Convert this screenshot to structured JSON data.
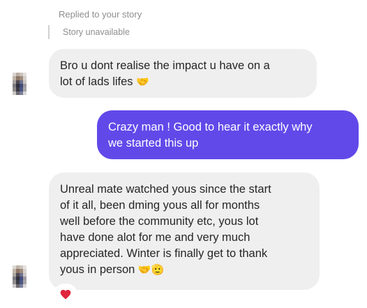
{
  "reply_header": "Replied to your story",
  "story_status": "Story unavailable",
  "messages": [
    {
      "direction": "incoming",
      "lines": [
        "Bro u dont realise the impact u have on a",
        "lot of lads lifes"
      ],
      "trailing_emoji": "🤝"
    },
    {
      "direction": "outgoing",
      "lines": [
        "Crazy man ! Good to hear it exactly why",
        "we started this up"
      ]
    },
    {
      "direction": "incoming",
      "lines": [
        "Unreal mate watched yous since the start",
        "of it all, been dming yous all for months",
        "well before the community etc, yous lot",
        "have done alot for me and very much",
        "appreciated. Winter is finally get to thank",
        "yous in person"
      ],
      "trailing_emoji": "🤝🫡"
    }
  ],
  "reaction": {
    "icon": "heart-icon",
    "color": "#e0243c"
  },
  "colors": {
    "incoming_bubble": "#efefef",
    "outgoing_bubble": "#6149e9",
    "meta_text": "#8e8e8e"
  }
}
